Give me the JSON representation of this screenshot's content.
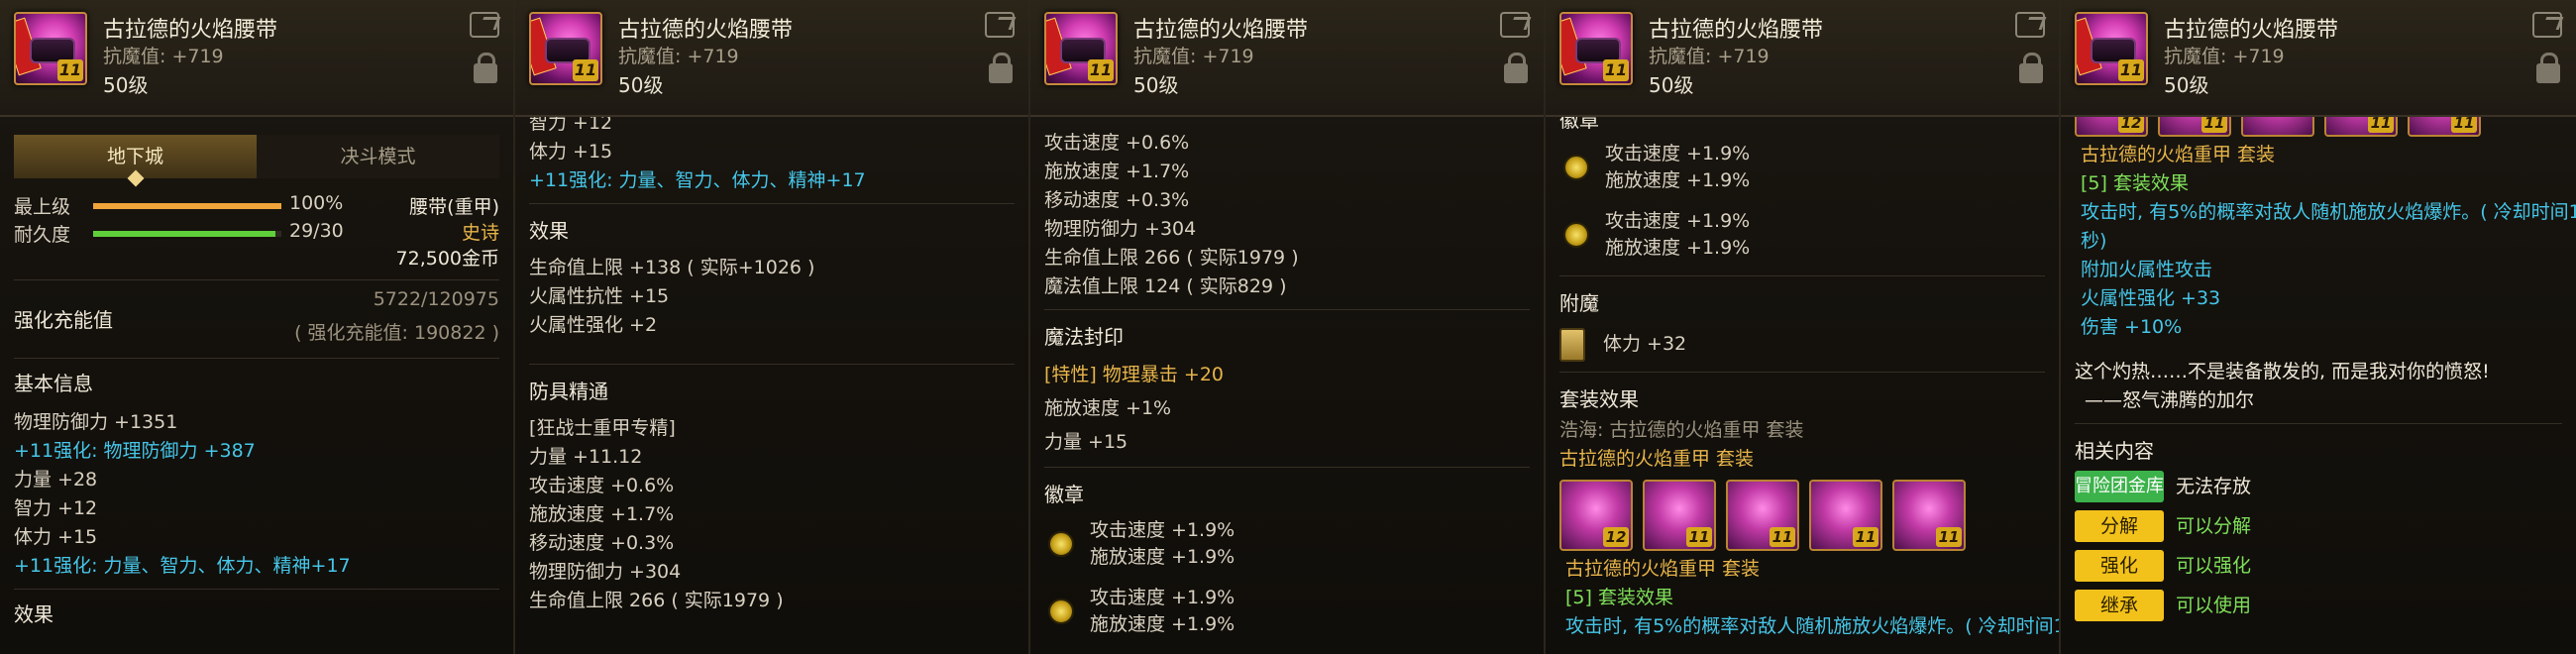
{
  "item": {
    "name": "古拉德的火焰腰带",
    "resist": "抗魔值: +719",
    "level": "50级",
    "badge": "11"
  },
  "p1": {
    "tabs": [
      "地下城",
      "决斗模式"
    ],
    "max_level_label": "最上级",
    "max_level_value": "100%",
    "durability_label": "耐久度",
    "durability_value": "29/30",
    "max_level_fraction": 1.0,
    "durability_fraction": 0.967,
    "slot_type": "腰带(重甲)",
    "rarity": "史诗",
    "price": "72,500金币",
    "charge_label": "强化充能值",
    "charge_value": "5722/120975",
    "charge_sub": "( 强化充能值: 190822 )",
    "basic_title": "基本信息",
    "lines": [
      {
        "text": "物理防御力 +1351",
        "cls": ""
      },
      {
        "text": "+11强化: 物理防御力 +387",
        "cls": "cy"
      },
      {
        "text": "力量 +28",
        "cls": ""
      },
      {
        "text": "智力 +12",
        "cls": ""
      },
      {
        "text": "体力 +15",
        "cls": ""
      },
      {
        "text": "+11强化: 力量、智力、体力、精神+17",
        "cls": "cy"
      }
    ],
    "effect_title": "效果"
  },
  "p2": {
    "top_lines": [
      {
        "text": "智力 +12",
        "cls": ""
      },
      {
        "text": "体力 +15",
        "cls": ""
      },
      {
        "text": "+11强化: 力量、智力、体力、精神+17",
        "cls": "cy"
      }
    ],
    "effect_title": "效果",
    "effect_lines": [
      "生命值上限 +138 ( 实际+1026 )",
      "火属性抗性 +15",
      "火属性强化 +2"
    ],
    "mastery_title": "防具精通",
    "mastery_lines": [
      "[狂战士重甲专精]",
      "力量 +11.12",
      "攻击速度 +0.6%",
      "施放速度 +1.7%",
      "移动速度 +0.3%",
      "物理防御力 +304",
      "生命值上限 266 ( 实际1979 )"
    ]
  },
  "p3": {
    "top_lines": [
      "攻击速度 +0.6%",
      "施放速度 +1.7%",
      "移动速度 +0.3%",
      "物理防御力 +304",
      "生命值上限 266 ( 实际1979 )",
      "魔法值上限 124 ( 实际829 )"
    ],
    "seal_title": "魔法封印",
    "seal_lines": [
      {
        "text": "[特性] 物理暴击 +20",
        "cls": "gold"
      },
      {
        "text": "施放速度 +1%",
        "cls": ""
      },
      {
        "text": "力量 +15",
        "cls": ""
      }
    ],
    "emblem_title": "徽章",
    "emblems": [
      {
        "a": "攻击速度 +1.9%",
        "b": "施放速度 +1.9%"
      },
      {
        "a": "攻击速度 +1.9%",
        "b": "施放速度 +1.9%"
      }
    ]
  },
  "p4": {
    "top_title": "徽章",
    "emblems": [
      {
        "a": "攻击速度 +1.9%",
        "b": "施放速度 +1.9%"
      },
      {
        "a": "攻击速度 +1.9%",
        "b": "施放速度 +1.9%"
      }
    ],
    "enchant_title": "附魔",
    "enchant_value": "体力 +32",
    "set_title": "套装效果",
    "set_source": "浩海: 古拉德的火焰重甲 套装",
    "set_name": "古拉德的火焰重甲 套装",
    "set_badges": [
      "12",
      "11",
      "11",
      "11",
      "11"
    ],
    "set_name2": "古拉德的火焰重甲 套装",
    "set_count": "[5] 套装效果",
    "set_desc": "攻击时, 有5%的概率对敌人随机施放火焰爆炸。( 冷却时间1"
  },
  "p5": {
    "set_badges": [
      "12",
      "11",
      "",
      "11",
      "11"
    ],
    "set_name": "古拉德的火焰重甲 套装",
    "set_count": "[5] 套装效果",
    "set_desc1": "攻击时, 有5%的概率对敌人随机施放火焰爆炸。( 冷却时间1",
    "set_desc2": "秒)",
    "extra1": "附加火属性攻击",
    "extra2": "火属性强化 +33",
    "extra3": "伤害 +10%",
    "flavor1": "这个灼热……不是装备散发的, 而是我对你的愤怒!",
    "flavor2": "——怒气沸腾的加尔",
    "related_title": "相关内容",
    "related": [
      {
        "btn": "冒险团金库",
        "note": "无法存放",
        "btn_type": "green",
        "note_cls": "wh"
      },
      {
        "btn": "分解",
        "note": "可以分解",
        "btn_type": "yellow",
        "note_cls": "gr"
      },
      {
        "btn": "强化",
        "note": "可以强化",
        "btn_type": "yellow",
        "note_cls": "gr"
      },
      {
        "btn": "继承",
        "note": "可以使用",
        "btn_type": "yellow",
        "note_cls": "gr"
      }
    ]
  },
  "colors": {
    "cyan": "#45c6e8",
    "green": "#7fe05a",
    "gold": "#e8b54a",
    "bar_orange": "#f0a33a",
    "bar_green": "#5fcf3a"
  }
}
